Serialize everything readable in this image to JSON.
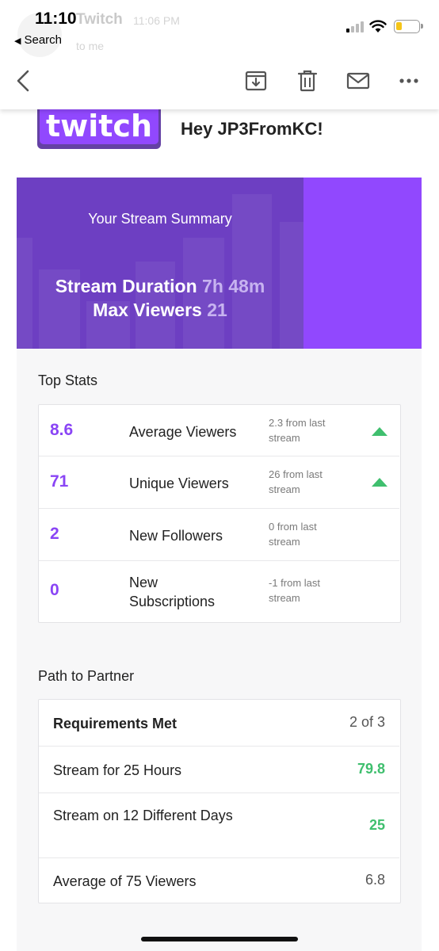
{
  "status_bar": {
    "time": "11:10",
    "back_label": "Search",
    "sender_ghost": "Twitch",
    "time_ghost": "11:06 PM",
    "to_ghost": "to me"
  },
  "toolbar": {
    "icons": [
      "back-icon",
      "archive-icon",
      "trash-icon",
      "mail-icon",
      "more-icon"
    ]
  },
  "email": {
    "logo_text": "twitch",
    "greeting": "Hey JP3FromKC!",
    "banner": {
      "title": "Your Stream Summary",
      "duration_label": "Stream Duration",
      "duration_value": "7h 48m",
      "viewers_label": "Max Viewers",
      "viewers_value": "21"
    },
    "top_stats": {
      "title": "Top Stats",
      "rows": [
        {
          "value": "8.6",
          "label": "Average Viewers",
          "change": "2.3 from last stream",
          "trend": "up"
        },
        {
          "value": "71",
          "label": "Unique Viewers",
          "change": "26 from last stream",
          "trend": "up"
        },
        {
          "value": "2",
          "label": "New Followers",
          "change": "0 from last stream",
          "trend": "none"
        },
        {
          "value": "0",
          "label": "New Subscriptions",
          "change": "-1 from last stream",
          "trend": "none"
        }
      ]
    },
    "path_to_partner": {
      "title": "Path to Partner",
      "rows": [
        {
          "label": "Requirements Met",
          "value": "2 of 3",
          "status": "header"
        },
        {
          "label": "Stream for 25 Hours",
          "value": "79.8",
          "status": "met"
        },
        {
          "label": "Stream on 12 Different Days",
          "value": "25",
          "status": "met"
        },
        {
          "label": "Average of 75 Viewers",
          "value": "6.8",
          "status": "unmet"
        }
      ]
    }
  },
  "colors": {
    "twitch_purple": "#9148fe",
    "banner_dark": "#6d3fc2",
    "stat_purple": "#8a45f5",
    "green": "#3fbf6e"
  }
}
